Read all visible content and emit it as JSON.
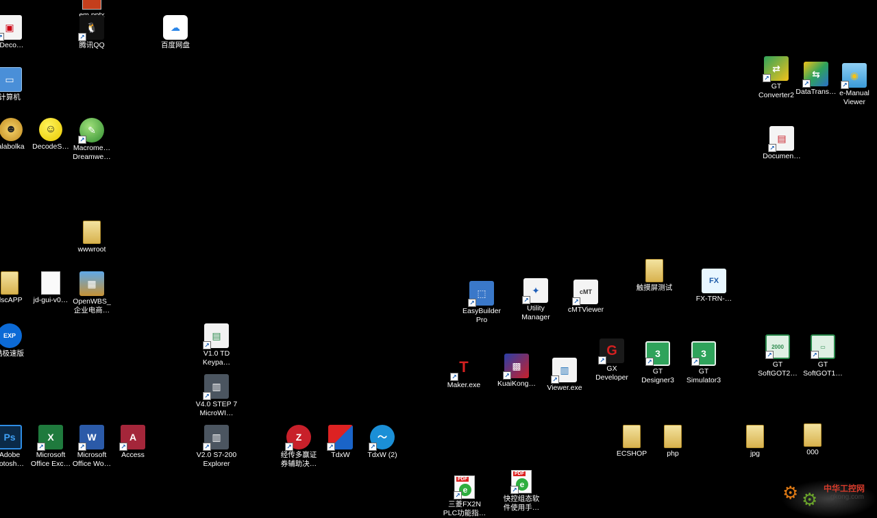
{
  "desktop": {
    "icons": [
      {
        "label": "em.pptx",
        "icon": "pptx-icon",
        "shortcut": false
      },
      {
        "label": "pDeco…",
        "icon": "pdf-decoder-icon",
        "shortcut": true
      },
      {
        "label": "腾讯QQ",
        "icon": "qq-penguin-icon",
        "shortcut": true
      },
      {
        "label": "百度网盘",
        "icon": "baidu-netdisk-icon",
        "shortcut": false
      },
      {
        "label": "计算机",
        "icon": "computer-icon",
        "shortcut": false
      },
      {
        "label": "alabolka",
        "icon": "balabolka-icon",
        "shortcut": false
      },
      {
        "label": "DecodeS…",
        "icon": "smiley-icon",
        "shortcut": false
      },
      {
        "label": "Macrome…\nDreamwe…",
        "icon": "dreamweaver-icon",
        "shortcut": true
      },
      {
        "label": "wwwroot",
        "icon": "folder-icon",
        "shortcut": false
      },
      {
        "label": "dscAPP",
        "icon": "folder-icon",
        "shortcut": false
      },
      {
        "label": "jd-gui-v0…",
        "icon": "file-icon",
        "shortcut": false
      },
      {
        "label": "OpenWBS_\n企业电商…",
        "icon": "archive-icon",
        "shortcut": false
      },
      {
        "label": "酷极速版",
        "icon": "exp-icon",
        "shortcut": false
      },
      {
        "label": "V1.0 TD\nKeypa…",
        "icon": "td-keypad-icon",
        "shortcut": true
      },
      {
        "label": "V4.0 STEP 7\nMicroWI…",
        "icon": "step7-icon",
        "shortcut": true
      },
      {
        "label": "Adobe\nhotosh…",
        "icon": "photoshop-icon",
        "shortcut": false
      },
      {
        "label": "Microsoft\nOffice Exc…",
        "icon": "excel-icon",
        "shortcut": true
      },
      {
        "label": "Microsoft\nOffice Wo…",
        "icon": "word-icon",
        "shortcut": true
      },
      {
        "label": "Access",
        "icon": "access-icon",
        "shortcut": true
      },
      {
        "label": "V2.0 S7-200\nExplorer",
        "icon": "s7-explorer-icon",
        "shortcut": true
      },
      {
        "label": "经传多赢证\n券辅助决…",
        "icon": "jingchuan-icon",
        "shortcut": true
      },
      {
        "label": "TdxW",
        "icon": "tdxw-icon",
        "shortcut": true
      },
      {
        "label": "TdxW (2)",
        "icon": "tdxw-icon",
        "shortcut": true
      },
      {
        "label": "三菱FX2N\nPLC功能指…",
        "icon": "pdf-icon",
        "shortcut": true
      },
      {
        "label": "快控组态软\n件使用手…",
        "icon": "pdf-icon",
        "shortcut": true
      },
      {
        "label": "EasyBuilder\nPro",
        "icon": "easybuilder-icon",
        "shortcut": true
      },
      {
        "label": "Utility\nManager",
        "icon": "utility-manager-icon",
        "shortcut": true
      },
      {
        "label": "cMTViewer",
        "icon": "cmtviewer-icon",
        "shortcut": true
      },
      {
        "label": "触摸屏测试",
        "icon": "folder-icon",
        "shortcut": false
      },
      {
        "label": "FX-TRN-…",
        "icon": "fx-trn-icon",
        "shortcut": false
      },
      {
        "label": "Maker.exe",
        "icon": "maker-icon",
        "shortcut": true
      },
      {
        "label": "KuaiKong…",
        "icon": "kuaikong-icon",
        "shortcut": true
      },
      {
        "label": "Viewer.exe",
        "icon": "viewer-icon",
        "shortcut": true
      },
      {
        "label": "GX\nDeveloper",
        "icon": "gx-developer-icon",
        "shortcut": true
      },
      {
        "label": "GT\nDesigner3",
        "icon": "gt-designer-icon",
        "shortcut": true
      },
      {
        "label": "GT\nSimulator3",
        "icon": "gt-simulator-icon",
        "shortcut": true
      },
      {
        "label": "GT\nSoftGOT2…",
        "icon": "softgot-icon",
        "shortcut": true
      },
      {
        "label": "GT\nSoftGOT1…",
        "icon": "softgot-icon",
        "shortcut": true
      },
      {
        "label": "ECSHOP",
        "icon": "folder-icon",
        "shortcut": false
      },
      {
        "label": "php",
        "icon": "folder-icon",
        "shortcut": false
      },
      {
        "label": "jpg",
        "icon": "folder-icon",
        "shortcut": false
      },
      {
        "label": "000",
        "icon": "folder-icon",
        "shortcut": false
      },
      {
        "label": "GT\nConverter2",
        "icon": "gt-converter-icon",
        "shortcut": true
      },
      {
        "label": "DataTrans…",
        "icon": "datatrans-icon",
        "shortcut": true
      },
      {
        "label": "e-Manual\nViewer",
        "icon": "emanual-icon",
        "shortcut": true
      },
      {
        "label": "Documen…",
        "icon": "document-icon",
        "shortcut": true
      }
    ]
  },
  "watermark": {
    "title": "中华工控网",
    "url": "gkong.com"
  }
}
